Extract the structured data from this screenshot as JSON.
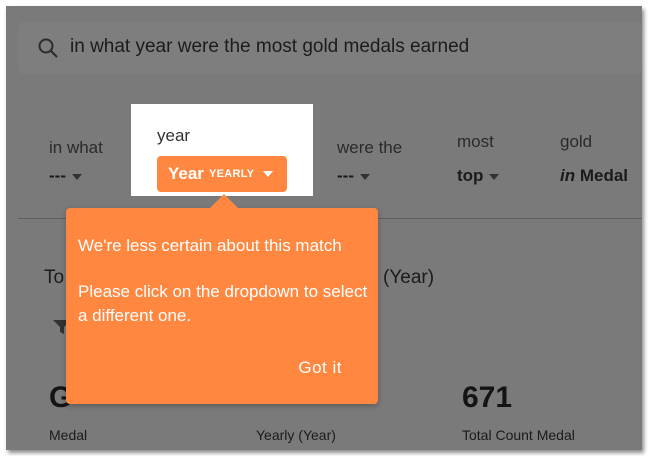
{
  "search": {
    "query": "in what year were the most gold medals earned"
  },
  "tokens": [
    {
      "label": "in what",
      "value": "---"
    },
    {
      "label": "year",
      "value": "Year",
      "badge": "YEARLY"
    },
    {
      "label": "were the",
      "value": "---"
    },
    {
      "label": "most",
      "value": "top"
    },
    {
      "label": "gold",
      "value_prefix": "in",
      "value": "Medal"
    }
  ],
  "results": {
    "title_left": "To",
    "title_right": "ly (Year)",
    "stats": [
      {
        "value": "G",
        "label": "Medal"
      },
      {
        "value": "",
        "label": "Yearly (Year)"
      },
      {
        "value": "671",
        "label": "Total Count Medal"
      }
    ]
  },
  "popover": {
    "title": "We're less certain about this match",
    "body": "Please click on the dropdown to select a different one.",
    "button": "Got it"
  },
  "colors": {
    "accent": "#ff8740",
    "overlay": "#7a7a7a"
  }
}
